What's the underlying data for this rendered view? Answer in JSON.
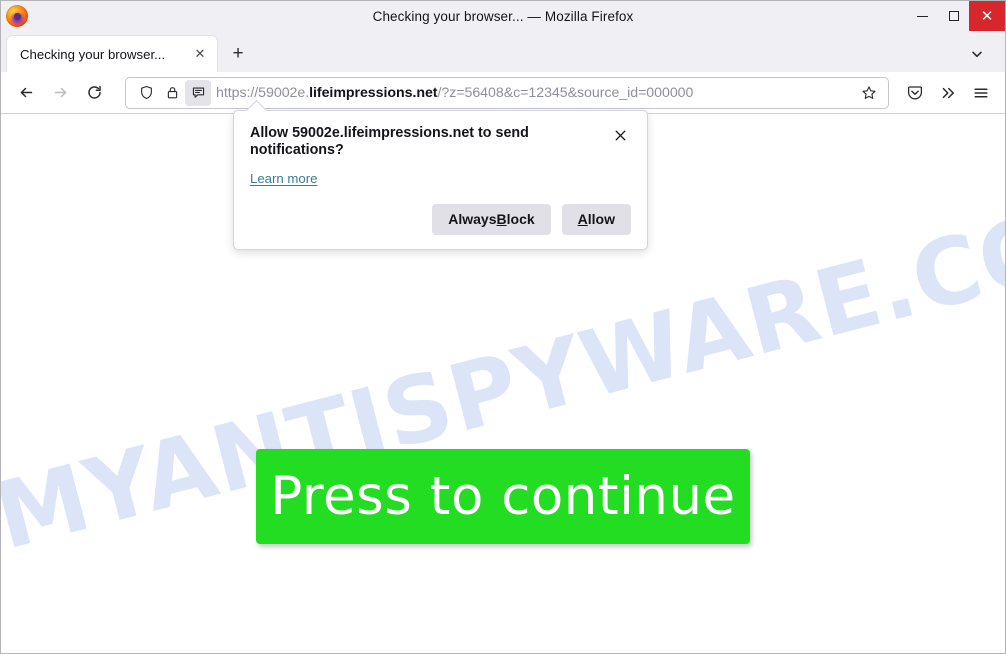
{
  "window": {
    "title": "Checking your browser... — Mozilla Firefox",
    "minimize_label": "Minimize",
    "maximize_label": "Maximize",
    "close_label": "✕"
  },
  "tabs": {
    "items": [
      {
        "title": "Checking your browser...",
        "close_label": "✕"
      }
    ],
    "new_tab_label": "+",
    "list_all_tabs_label": "List all tabs"
  },
  "toolbar": {
    "back_label": "Back",
    "forward_label": "Forward",
    "reload_label": "Reload",
    "pocket_label": "Save to Pocket",
    "overflow_label": "More tools",
    "menu_label": "Open application menu"
  },
  "urlbar": {
    "scheme": "https://59002e.",
    "domain": "lifeimpressions.net",
    "path": "/?z=56408&c=12345&source_id=000000",
    "full_url": "https://59002e.lifeimpressions.net/?z=56408&c=12345&source_id=000000",
    "shield_label": "Enhanced tracking protection",
    "lock_label": "Connection secure",
    "notification_icon_label": "Notification permission request",
    "bookmark_label": "Bookmark this page"
  },
  "popup": {
    "title": "Allow 59002e.lifeimpressions.net to send notifications?",
    "learn_more": "Learn more",
    "close_label": "✕",
    "buttons": {
      "block_prefix": "Always ",
      "block_key": "B",
      "block_suffix": "lock",
      "allow_key": "A",
      "allow_suffix": "llow"
    }
  },
  "page": {
    "watermark": "MYANTISPYWARE.COM",
    "button_label": "Press to continue"
  },
  "colors": {
    "accent_green": "#22dd22",
    "close_red": "#d7262c",
    "watermark_blue": "#dbe5f7",
    "link_blue": "#3a7b9a"
  }
}
